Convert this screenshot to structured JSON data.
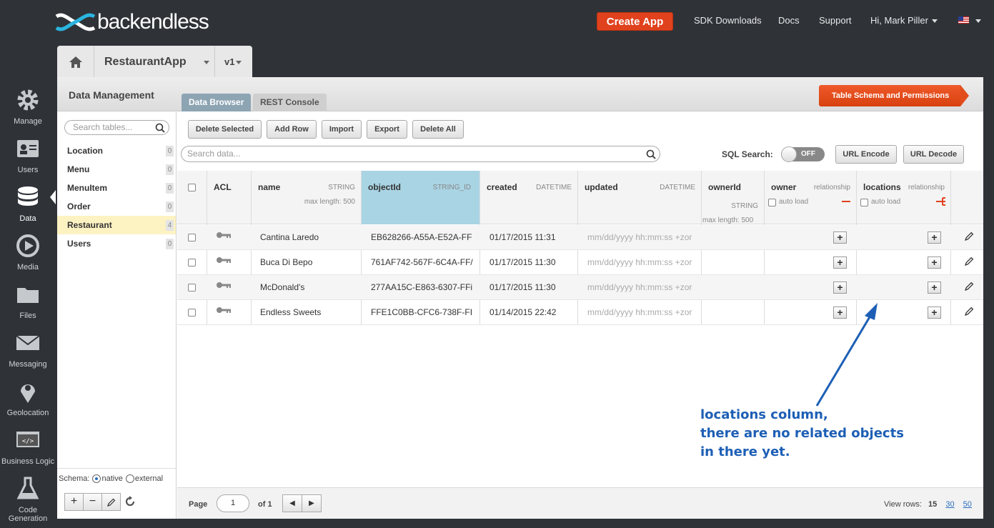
{
  "topbar": {
    "logo_text": "backendless",
    "create_app": "Create App",
    "links": [
      "SDK Downloads",
      "Docs",
      "Support"
    ],
    "user_menu": "Hi, Mark Piller"
  },
  "leftnav": {
    "items": [
      {
        "label": "Manage",
        "icon": "gear-icon"
      },
      {
        "label": "Users",
        "icon": "users-icon"
      },
      {
        "label": "Data",
        "icon": "database-icon"
      },
      {
        "label": "Media",
        "icon": "media-icon"
      },
      {
        "label": "Files",
        "icon": "folder-icon"
      },
      {
        "label": "Messaging",
        "icon": "envelope-icon"
      },
      {
        "label": "Geolocation",
        "icon": "location-pin-icon"
      },
      {
        "label": "Business Logic",
        "icon": "code-icon"
      },
      {
        "label": "Code Generation",
        "icon": "flask-icon"
      }
    ],
    "active": "Data"
  },
  "appbar": {
    "app_name": "RestaurantApp",
    "version": "v1"
  },
  "header": {
    "title": "Data Management",
    "tabs": [
      {
        "label": "Data Browser"
      },
      {
        "label": "REST Console"
      }
    ],
    "schema_button": "Table Schema and Permissions"
  },
  "tables": {
    "search_placeholder": "Search tables...",
    "items": [
      {
        "name": "Location",
        "count": "0"
      },
      {
        "name": "Menu",
        "count": "0"
      },
      {
        "name": "MenuItem",
        "count": "0"
      },
      {
        "name": "Order",
        "count": "0"
      },
      {
        "name": "Restaurant",
        "count": "4"
      },
      {
        "name": "Users",
        "count": "0"
      }
    ],
    "selected": "Restaurant",
    "schema_label": "Schema:",
    "schema_native": "native",
    "schema_external": "external"
  },
  "toolbar": {
    "delete_selected": "Delete Selected",
    "add_row": "Add Row",
    "import": "Import",
    "export": "Export",
    "delete_all": "Delete All",
    "search_placeholder": "Search data...",
    "sql_search": "SQL Search:",
    "sql_toggle": "OFF",
    "url_encode": "URL Encode",
    "url_decode": "URL Decode"
  },
  "grid": {
    "columns": {
      "acl": "ACL",
      "name": {
        "title": "name",
        "type": "STRING",
        "sub": "max length: 500"
      },
      "objectId": {
        "title": "objectId",
        "type": "STRING_ID"
      },
      "created": {
        "title": "created",
        "type": "DATETIME"
      },
      "updated": {
        "title": "updated",
        "type": "DATETIME"
      },
      "ownerId": {
        "title": "ownerId",
        "type": "STRING",
        "sub": "max length: 500"
      },
      "owner": {
        "title": "owner",
        "type": "relationship",
        "sub": "auto load"
      },
      "locations": {
        "title": "locations",
        "type": "relationship",
        "sub": "auto load"
      }
    },
    "rows": [
      {
        "name": "Cantina Laredo",
        "objectId": "EB628266-A55A-E52A-FF",
        "created": "01/17/2015 11:31",
        "updated": "mm/dd/yyyy hh:mm:ss +zor"
      },
      {
        "name": "Buca Di Bepo",
        "objectId": "761AF742-567F-6C4A-FF/",
        "created": "01/17/2015 11:30",
        "updated": "mm/dd/yyyy hh:mm:ss +zor"
      },
      {
        "name": "McDonald's",
        "objectId": "277AA15C-E863-6307-FFi",
        "created": "01/17/2015 11:30",
        "updated": "mm/dd/yyyy hh:mm:ss +zor"
      },
      {
        "name": "Endless Sweets",
        "objectId": "FFE1C0BB-CFC6-738F-FI",
        "created": "01/14/2015 22:42",
        "updated": "mm/dd/yyyy hh:mm:ss +zor"
      }
    ]
  },
  "annotation": {
    "lines": [
      "locations column,",
      "there are no related objects",
      "in there yet."
    ],
    "color": "#1d5fb5"
  },
  "footer": {
    "page_label": "Page",
    "page_value": "1",
    "of_label": "of 1",
    "view_rows_label": "View rows:",
    "view_rows_current": "15",
    "view_rows_options": [
      "30",
      "50"
    ]
  },
  "colors": {
    "accent": "#e0421e",
    "brand": "#2ab5e0",
    "selected_table": "#fdf2c2",
    "objectid_header": "#a9d4e4"
  }
}
